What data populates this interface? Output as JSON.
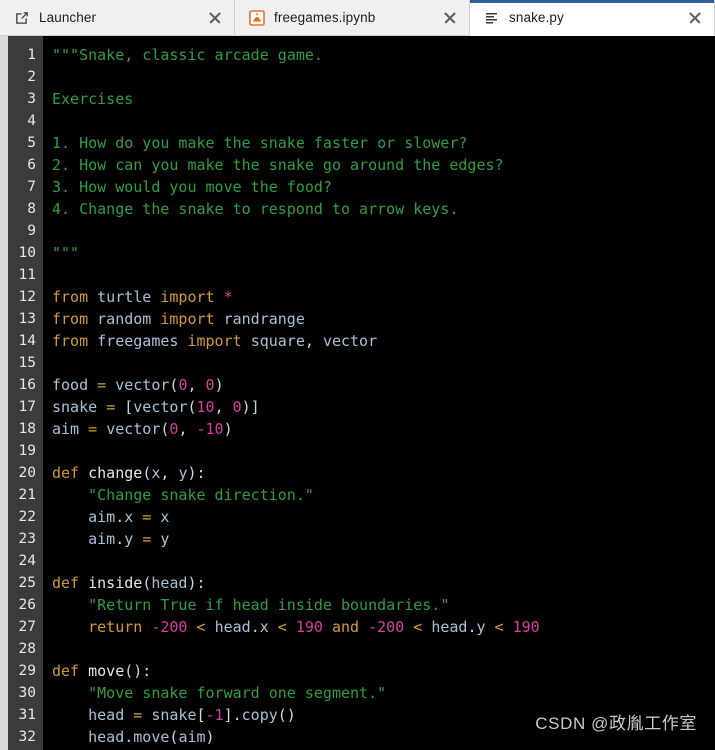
{
  "window": {
    "app": "JupyterLab",
    "active_tab_index": 2
  },
  "tabs": [
    {
      "label": "Launcher",
      "icon": "launcher-icon",
      "active": false,
      "close_label": "close"
    },
    {
      "label": "freegames.ipynb",
      "icon": "notebook-icon",
      "active": false,
      "close_label": "close"
    },
    {
      "label": "snake.py",
      "icon": "python-file-icon",
      "active": true,
      "close_label": "close"
    }
  ],
  "editor": {
    "language": "Python",
    "filename": "snake.py",
    "first_line": 1,
    "last_line": 32,
    "background": "#000000",
    "gutter_background": "#3b3b3b",
    "lines": [
      {
        "n": 1,
        "tokens": [
          {
            "t": "\"\"\"Snake, classic arcade game.",
            "c": "t-doc"
          }
        ]
      },
      {
        "n": 2,
        "tokens": []
      },
      {
        "n": 3,
        "tokens": [
          {
            "t": "Exercises",
            "c": "t-doc"
          }
        ]
      },
      {
        "n": 4,
        "tokens": []
      },
      {
        "n": 5,
        "tokens": [
          {
            "t": "1. How do you make the snake faster or slower?",
            "c": "t-doc"
          }
        ]
      },
      {
        "n": 6,
        "tokens": [
          {
            "t": "2. How can you make the snake go around the edges?",
            "c": "t-doc"
          }
        ]
      },
      {
        "n": 7,
        "tokens": [
          {
            "t": "3. How would you move the food?",
            "c": "t-doc"
          }
        ]
      },
      {
        "n": 8,
        "tokens": [
          {
            "t": "4. Change the snake to respond to arrow keys.",
            "c": "t-doc"
          }
        ]
      },
      {
        "n": 9,
        "tokens": []
      },
      {
        "n": 10,
        "tokens": [
          {
            "t": "\"\"\"",
            "c": "t-doc"
          }
        ]
      },
      {
        "n": 11,
        "tokens": []
      },
      {
        "n": 12,
        "tokens": [
          {
            "t": "from",
            "c": "t-kw"
          },
          {
            "t": " ",
            "c": "t-plain"
          },
          {
            "t": "turtle",
            "c": "t-var"
          },
          {
            "t": " ",
            "c": "t-plain"
          },
          {
            "t": "import",
            "c": "t-kw"
          },
          {
            "t": " ",
            "c": "t-plain"
          },
          {
            "t": "*",
            "c": "t-star"
          }
        ]
      },
      {
        "n": 13,
        "tokens": [
          {
            "t": "from",
            "c": "t-kw"
          },
          {
            "t": " ",
            "c": "t-plain"
          },
          {
            "t": "random",
            "c": "t-var"
          },
          {
            "t": " ",
            "c": "t-plain"
          },
          {
            "t": "import",
            "c": "t-kw"
          },
          {
            "t": " ",
            "c": "t-plain"
          },
          {
            "t": "randrange",
            "c": "t-var"
          }
        ]
      },
      {
        "n": 14,
        "tokens": [
          {
            "t": "from",
            "c": "t-kw"
          },
          {
            "t": " ",
            "c": "t-plain"
          },
          {
            "t": "freegames",
            "c": "t-var"
          },
          {
            "t": " ",
            "c": "t-plain"
          },
          {
            "t": "import",
            "c": "t-kw"
          },
          {
            "t": " ",
            "c": "t-plain"
          },
          {
            "t": "square",
            "c": "t-var"
          },
          {
            "t": ", ",
            "c": "t-punc"
          },
          {
            "t": "vector",
            "c": "t-var"
          }
        ]
      },
      {
        "n": 15,
        "tokens": []
      },
      {
        "n": 16,
        "tokens": [
          {
            "t": "food",
            "c": "t-var"
          },
          {
            "t": " ",
            "c": "t-plain"
          },
          {
            "t": "=",
            "c": "t-op"
          },
          {
            "t": " ",
            "c": "t-plain"
          },
          {
            "t": "vector",
            "c": "t-var"
          },
          {
            "t": "(",
            "c": "t-punc"
          },
          {
            "t": "0",
            "c": "t-num"
          },
          {
            "t": ", ",
            "c": "t-punc"
          },
          {
            "t": "0",
            "c": "t-num"
          },
          {
            "t": ")",
            "c": "t-punc"
          }
        ]
      },
      {
        "n": 17,
        "tokens": [
          {
            "t": "snake",
            "c": "t-var"
          },
          {
            "t": " ",
            "c": "t-plain"
          },
          {
            "t": "=",
            "c": "t-op"
          },
          {
            "t": " ",
            "c": "t-plain"
          },
          {
            "t": "[",
            "c": "t-punc"
          },
          {
            "t": "vector",
            "c": "t-var"
          },
          {
            "t": "(",
            "c": "t-punc"
          },
          {
            "t": "10",
            "c": "t-num"
          },
          {
            "t": ", ",
            "c": "t-punc"
          },
          {
            "t": "0",
            "c": "t-num"
          },
          {
            "t": ")]",
            "c": "t-punc"
          }
        ]
      },
      {
        "n": 18,
        "tokens": [
          {
            "t": "aim",
            "c": "t-var"
          },
          {
            "t": " ",
            "c": "t-plain"
          },
          {
            "t": "=",
            "c": "t-op"
          },
          {
            "t": " ",
            "c": "t-plain"
          },
          {
            "t": "vector",
            "c": "t-var"
          },
          {
            "t": "(",
            "c": "t-punc"
          },
          {
            "t": "0",
            "c": "t-num"
          },
          {
            "t": ", ",
            "c": "t-punc"
          },
          {
            "t": "-10",
            "c": "t-num"
          },
          {
            "t": ")",
            "c": "t-punc"
          }
        ]
      },
      {
        "n": 19,
        "tokens": []
      },
      {
        "n": 20,
        "tokens": [
          {
            "t": "def",
            "c": "t-kw"
          },
          {
            "t": " ",
            "c": "t-plain"
          },
          {
            "t": "change",
            "c": "t-name"
          },
          {
            "t": "(",
            "c": "t-punc"
          },
          {
            "t": "x",
            "c": "t-var"
          },
          {
            "t": ", ",
            "c": "t-punc"
          },
          {
            "t": "y",
            "c": "t-var"
          },
          {
            "t": "):",
            "c": "t-punc"
          }
        ]
      },
      {
        "n": 21,
        "tokens": [
          {
            "t": "    \"Change snake direction.\"",
            "c": "t-str"
          }
        ]
      },
      {
        "n": 22,
        "tokens": [
          {
            "t": "    ",
            "c": "t-plain"
          },
          {
            "t": "aim",
            "c": "t-var"
          },
          {
            "t": ".",
            "c": "t-punc"
          },
          {
            "t": "x",
            "c": "t-var"
          },
          {
            "t": " ",
            "c": "t-plain"
          },
          {
            "t": "=",
            "c": "t-op"
          },
          {
            "t": " ",
            "c": "t-plain"
          },
          {
            "t": "x",
            "c": "t-var"
          }
        ]
      },
      {
        "n": 23,
        "tokens": [
          {
            "t": "    ",
            "c": "t-plain"
          },
          {
            "t": "aim",
            "c": "t-var"
          },
          {
            "t": ".",
            "c": "t-punc"
          },
          {
            "t": "y",
            "c": "t-var"
          },
          {
            "t": " ",
            "c": "t-plain"
          },
          {
            "t": "=",
            "c": "t-op"
          },
          {
            "t": " ",
            "c": "t-plain"
          },
          {
            "t": "y",
            "c": "t-var"
          }
        ]
      },
      {
        "n": 24,
        "tokens": []
      },
      {
        "n": 25,
        "tokens": [
          {
            "t": "def",
            "c": "t-kw"
          },
          {
            "t": " ",
            "c": "t-plain"
          },
          {
            "t": "inside",
            "c": "t-name"
          },
          {
            "t": "(",
            "c": "t-punc"
          },
          {
            "t": "head",
            "c": "t-var"
          },
          {
            "t": "):",
            "c": "t-punc"
          }
        ]
      },
      {
        "n": 26,
        "tokens": [
          {
            "t": "    \"Return True if head inside boundaries.\"",
            "c": "t-str"
          }
        ]
      },
      {
        "n": 27,
        "tokens": [
          {
            "t": "    ",
            "c": "t-plain"
          },
          {
            "t": "return",
            "c": "t-kw"
          },
          {
            "t": " ",
            "c": "t-plain"
          },
          {
            "t": "-200",
            "c": "t-num"
          },
          {
            "t": " ",
            "c": "t-plain"
          },
          {
            "t": "<",
            "c": "t-op"
          },
          {
            "t": " ",
            "c": "t-plain"
          },
          {
            "t": "head",
            "c": "t-var"
          },
          {
            "t": ".",
            "c": "t-punc"
          },
          {
            "t": "x",
            "c": "t-var"
          },
          {
            "t": " ",
            "c": "t-plain"
          },
          {
            "t": "<",
            "c": "t-op"
          },
          {
            "t": " ",
            "c": "t-plain"
          },
          {
            "t": "190",
            "c": "t-num"
          },
          {
            "t": " ",
            "c": "t-plain"
          },
          {
            "t": "and",
            "c": "t-kw"
          },
          {
            "t": " ",
            "c": "t-plain"
          },
          {
            "t": "-200",
            "c": "t-num"
          },
          {
            "t": " ",
            "c": "t-plain"
          },
          {
            "t": "<",
            "c": "t-op"
          },
          {
            "t": " ",
            "c": "t-plain"
          },
          {
            "t": "head",
            "c": "t-var"
          },
          {
            "t": ".",
            "c": "t-punc"
          },
          {
            "t": "y",
            "c": "t-var"
          },
          {
            "t": " ",
            "c": "t-plain"
          },
          {
            "t": "<",
            "c": "t-op"
          },
          {
            "t": " ",
            "c": "t-plain"
          },
          {
            "t": "190",
            "c": "t-num"
          }
        ]
      },
      {
        "n": 28,
        "tokens": []
      },
      {
        "n": 29,
        "tokens": [
          {
            "t": "def",
            "c": "t-kw"
          },
          {
            "t": " ",
            "c": "t-plain"
          },
          {
            "t": "move",
            "c": "t-name"
          },
          {
            "t": "():",
            "c": "t-punc"
          }
        ]
      },
      {
        "n": 30,
        "tokens": [
          {
            "t": "    \"Move snake forward one segment.\"",
            "c": "t-str"
          }
        ]
      },
      {
        "n": 31,
        "tokens": [
          {
            "t": "    ",
            "c": "t-plain"
          },
          {
            "t": "head",
            "c": "t-var"
          },
          {
            "t": " ",
            "c": "t-plain"
          },
          {
            "t": "=",
            "c": "t-op"
          },
          {
            "t": " ",
            "c": "t-plain"
          },
          {
            "t": "snake",
            "c": "t-var"
          },
          {
            "t": "[",
            "c": "t-punc"
          },
          {
            "t": "-1",
            "c": "t-num"
          },
          {
            "t": "].",
            "c": "t-punc"
          },
          {
            "t": "copy",
            "c": "t-var"
          },
          {
            "t": "()",
            "c": "t-punc"
          }
        ]
      },
      {
        "n": 32,
        "tokens": [
          {
            "t": "    ",
            "c": "t-plain"
          },
          {
            "t": "head",
            "c": "t-var"
          },
          {
            "t": ".",
            "c": "t-punc"
          },
          {
            "t": "move",
            "c": "t-var"
          },
          {
            "t": "(",
            "c": "t-punc"
          },
          {
            "t": "aim",
            "c": "t-var"
          },
          {
            "t": ")",
            "c": "t-punc"
          }
        ]
      }
    ]
  },
  "watermark": {
    "text": "CSDN @政胤工作室"
  },
  "colors": {
    "editor_bg": "#000000",
    "gutter_bg": "#3b3b3b",
    "active_tab_accent": "#2c5f9e",
    "string_green": "#2e9e41",
    "keyword_orange": "#d19a35",
    "number_magenta": "#d43fa0",
    "identifier_blue": "#a8c1d8"
  }
}
